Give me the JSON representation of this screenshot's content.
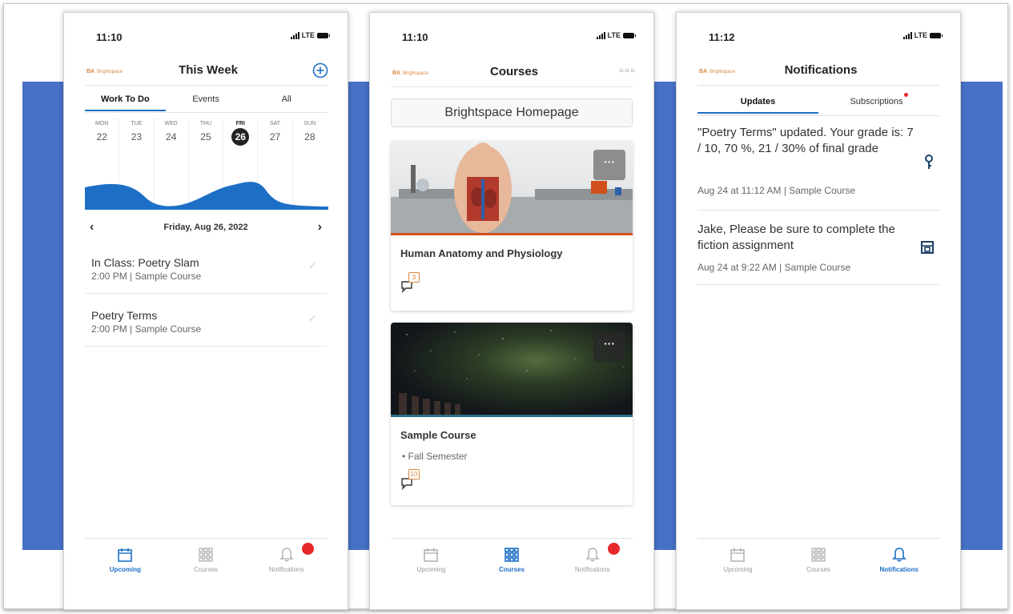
{
  "common": {
    "brand": "Brightspace",
    "nav": {
      "upcoming": "Upcoming",
      "courses": "Courses",
      "notifications": "Notifications"
    },
    "signal": "LTE"
  },
  "phone1": {
    "time": "11:10",
    "title": "This Week",
    "tabs": [
      "Work To Do",
      "Events",
      "All"
    ],
    "days": [
      {
        "name": "MON",
        "num": "22"
      },
      {
        "name": "TUE",
        "num": "23"
      },
      {
        "name": "WED",
        "num": "24"
      },
      {
        "name": "THU",
        "num": "25"
      },
      {
        "name": "FRI",
        "num": "26"
      },
      {
        "name": "SAT",
        "num": "27"
      },
      {
        "name": "SUN",
        "num": "28"
      }
    ],
    "selected_date": "Friday, Aug 26, 2022",
    "tasks": [
      {
        "title": "In Class: Poetry Slam",
        "meta": "2:00 PM | Sample Course"
      },
      {
        "title": "Poetry Terms",
        "meta": "2:00 PM | Sample Course"
      }
    ]
  },
  "phone2": {
    "time": "11:10",
    "title": "Courses",
    "home_button": "Brightspace Homepage",
    "courses": [
      {
        "name": "Human Anatomy and Physiology",
        "sub": "",
        "badge": "3"
      },
      {
        "name": "Sample Course",
        "sub": "• Fall Semester",
        "badge": "10"
      }
    ]
  },
  "phone3": {
    "time": "11:12",
    "title": "Notifications",
    "tabs": [
      "Updates",
      "Subscriptions"
    ],
    "items": [
      {
        "text": "\"Poetry Terms\" updated. Your grade is: 7 / 10, 70 %, 21 / 30% of final grade",
        "meta": "Aug 24 at 11:12 AM | Sample Course",
        "icon": "key-icon"
      },
      {
        "text": "Jake, Please be sure to complete the fiction assignment",
        "meta": "Aug 24 at 9:22 AM | Sample Course",
        "icon": "assignment-icon"
      }
    ]
  },
  "colors": {
    "accent": "#1d6fc6",
    "band": "#4671c6",
    "brand": "#d9893f",
    "alert": "#e6282a"
  }
}
